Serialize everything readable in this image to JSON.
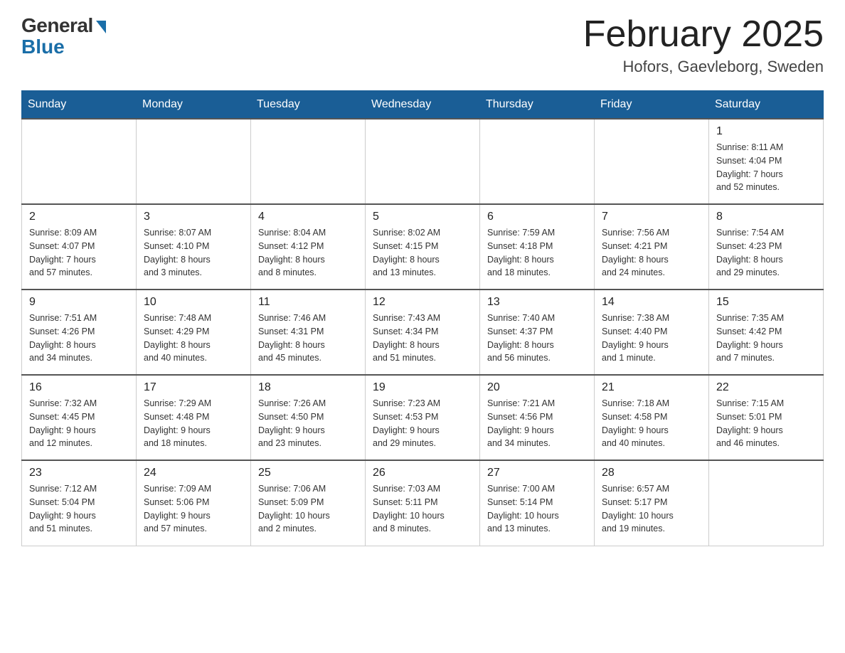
{
  "header": {
    "logo_general": "General",
    "logo_blue": "Blue",
    "month_title": "February 2025",
    "location": "Hofors, Gaevleborg, Sweden"
  },
  "days_of_week": [
    "Sunday",
    "Monday",
    "Tuesday",
    "Wednesday",
    "Thursday",
    "Friday",
    "Saturday"
  ],
  "weeks": [
    {
      "days": [
        {
          "number": "",
          "info": "",
          "empty": true
        },
        {
          "number": "",
          "info": "",
          "empty": true
        },
        {
          "number": "",
          "info": "",
          "empty": true
        },
        {
          "number": "",
          "info": "",
          "empty": true
        },
        {
          "number": "",
          "info": "",
          "empty": true
        },
        {
          "number": "",
          "info": "",
          "empty": true
        },
        {
          "number": "1",
          "info": "Sunrise: 8:11 AM\nSunset: 4:04 PM\nDaylight: 7 hours\nand 52 minutes.",
          "empty": false
        }
      ]
    },
    {
      "days": [
        {
          "number": "2",
          "info": "Sunrise: 8:09 AM\nSunset: 4:07 PM\nDaylight: 7 hours\nand 57 minutes.",
          "empty": false
        },
        {
          "number": "3",
          "info": "Sunrise: 8:07 AM\nSunset: 4:10 PM\nDaylight: 8 hours\nand 3 minutes.",
          "empty": false
        },
        {
          "number": "4",
          "info": "Sunrise: 8:04 AM\nSunset: 4:12 PM\nDaylight: 8 hours\nand 8 minutes.",
          "empty": false
        },
        {
          "number": "5",
          "info": "Sunrise: 8:02 AM\nSunset: 4:15 PM\nDaylight: 8 hours\nand 13 minutes.",
          "empty": false
        },
        {
          "number": "6",
          "info": "Sunrise: 7:59 AM\nSunset: 4:18 PM\nDaylight: 8 hours\nand 18 minutes.",
          "empty": false
        },
        {
          "number": "7",
          "info": "Sunrise: 7:56 AM\nSunset: 4:21 PM\nDaylight: 8 hours\nand 24 minutes.",
          "empty": false
        },
        {
          "number": "8",
          "info": "Sunrise: 7:54 AM\nSunset: 4:23 PM\nDaylight: 8 hours\nand 29 minutes.",
          "empty": false
        }
      ]
    },
    {
      "days": [
        {
          "number": "9",
          "info": "Sunrise: 7:51 AM\nSunset: 4:26 PM\nDaylight: 8 hours\nand 34 minutes.",
          "empty": false
        },
        {
          "number": "10",
          "info": "Sunrise: 7:48 AM\nSunset: 4:29 PM\nDaylight: 8 hours\nand 40 minutes.",
          "empty": false
        },
        {
          "number": "11",
          "info": "Sunrise: 7:46 AM\nSunset: 4:31 PM\nDaylight: 8 hours\nand 45 minutes.",
          "empty": false
        },
        {
          "number": "12",
          "info": "Sunrise: 7:43 AM\nSunset: 4:34 PM\nDaylight: 8 hours\nand 51 minutes.",
          "empty": false
        },
        {
          "number": "13",
          "info": "Sunrise: 7:40 AM\nSunset: 4:37 PM\nDaylight: 8 hours\nand 56 minutes.",
          "empty": false
        },
        {
          "number": "14",
          "info": "Sunrise: 7:38 AM\nSunset: 4:40 PM\nDaylight: 9 hours\nand 1 minute.",
          "empty": false
        },
        {
          "number": "15",
          "info": "Sunrise: 7:35 AM\nSunset: 4:42 PM\nDaylight: 9 hours\nand 7 minutes.",
          "empty": false
        }
      ]
    },
    {
      "days": [
        {
          "number": "16",
          "info": "Sunrise: 7:32 AM\nSunset: 4:45 PM\nDaylight: 9 hours\nand 12 minutes.",
          "empty": false
        },
        {
          "number": "17",
          "info": "Sunrise: 7:29 AM\nSunset: 4:48 PM\nDaylight: 9 hours\nand 18 minutes.",
          "empty": false
        },
        {
          "number": "18",
          "info": "Sunrise: 7:26 AM\nSunset: 4:50 PM\nDaylight: 9 hours\nand 23 minutes.",
          "empty": false
        },
        {
          "number": "19",
          "info": "Sunrise: 7:23 AM\nSunset: 4:53 PM\nDaylight: 9 hours\nand 29 minutes.",
          "empty": false
        },
        {
          "number": "20",
          "info": "Sunrise: 7:21 AM\nSunset: 4:56 PM\nDaylight: 9 hours\nand 34 minutes.",
          "empty": false
        },
        {
          "number": "21",
          "info": "Sunrise: 7:18 AM\nSunset: 4:58 PM\nDaylight: 9 hours\nand 40 minutes.",
          "empty": false
        },
        {
          "number": "22",
          "info": "Sunrise: 7:15 AM\nSunset: 5:01 PM\nDaylight: 9 hours\nand 46 minutes.",
          "empty": false
        }
      ]
    },
    {
      "days": [
        {
          "number": "23",
          "info": "Sunrise: 7:12 AM\nSunset: 5:04 PM\nDaylight: 9 hours\nand 51 minutes.",
          "empty": false
        },
        {
          "number": "24",
          "info": "Sunrise: 7:09 AM\nSunset: 5:06 PM\nDaylight: 9 hours\nand 57 minutes.",
          "empty": false
        },
        {
          "number": "25",
          "info": "Sunrise: 7:06 AM\nSunset: 5:09 PM\nDaylight: 10 hours\nand 2 minutes.",
          "empty": false
        },
        {
          "number": "26",
          "info": "Sunrise: 7:03 AM\nSunset: 5:11 PM\nDaylight: 10 hours\nand 8 minutes.",
          "empty": false
        },
        {
          "number": "27",
          "info": "Sunrise: 7:00 AM\nSunset: 5:14 PM\nDaylight: 10 hours\nand 13 minutes.",
          "empty": false
        },
        {
          "number": "28",
          "info": "Sunrise: 6:57 AM\nSunset: 5:17 PM\nDaylight: 10 hours\nand 19 minutes.",
          "empty": false
        },
        {
          "number": "",
          "info": "",
          "empty": true
        }
      ]
    }
  ]
}
